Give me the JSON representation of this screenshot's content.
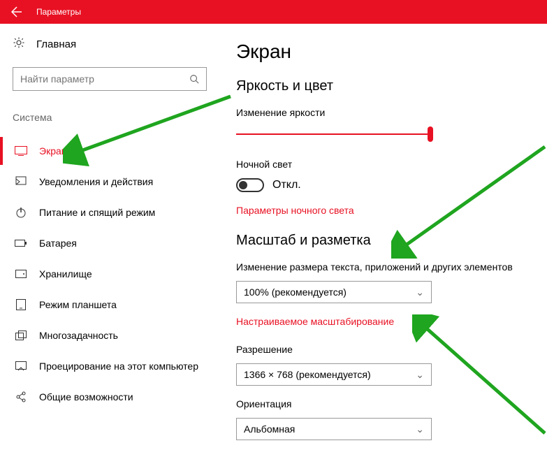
{
  "titlebar": {
    "text": "Параметры"
  },
  "sidebar": {
    "home": "Главная",
    "search_placeholder": "Найти параметр",
    "category": "Система",
    "items": [
      {
        "label": "Экран"
      },
      {
        "label": "Уведомления и действия"
      },
      {
        "label": "Питание и спящий режим"
      },
      {
        "label": "Батарея"
      },
      {
        "label": "Хранилище"
      },
      {
        "label": "Режим планшета"
      },
      {
        "label": "Многозадачность"
      },
      {
        "label": "Проецирование на этот компьютер"
      },
      {
        "label": "Общие возможности"
      }
    ]
  },
  "main": {
    "title": "Экран",
    "brightness_section": "Яркость и цвет",
    "brightness_label": "Изменение яркости",
    "night_light_label": "Ночной свет",
    "night_light_state": "Откл.",
    "night_light_link": "Параметры ночного света",
    "scale_section": "Масштаб и разметка",
    "scale_label": "Изменение размера текста, приложений и других элементов",
    "scale_value": "100% (рекомендуется)",
    "custom_scaling_link": "Настраиваемое масштабирование",
    "resolution_label": "Разрешение",
    "resolution_value": "1366 × 768 (рекомендуется)",
    "orientation_label": "Ориентация",
    "orientation_value": "Альбомная"
  }
}
